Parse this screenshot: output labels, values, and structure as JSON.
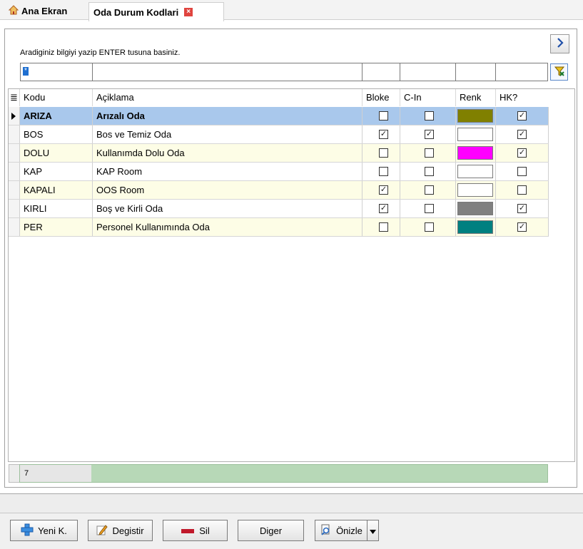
{
  "tabs": [
    {
      "label": "Ana Ekran",
      "icon": "home-icon"
    },
    {
      "label": "Oda Durum Kodlari",
      "active": true,
      "close_icon": "close-icon"
    }
  ],
  "search": {
    "hint": "Aradiginiz bilgiyi yazip ENTER tusuna basiniz.",
    "first_filter_value": "*"
  },
  "grid": {
    "columns": [
      "Kodu",
      "Açiklama",
      "Bloke",
      "C-In",
      "Renk",
      "HK?"
    ],
    "rows": [
      {
        "kodu": "ARIZA",
        "aciklama": "Arızalı Oda",
        "bloke": false,
        "cin": false,
        "renk": "#808000",
        "hk": true,
        "selected": true
      },
      {
        "kodu": "BOS",
        "aciklama": "Bos ve Temiz Oda",
        "bloke": true,
        "cin": true,
        "renk": "#ffffff",
        "hk": true
      },
      {
        "kodu": "DOLU",
        "aciklama": "Kullanımda Dolu Oda",
        "bloke": false,
        "cin": false,
        "renk": "#ff00ff",
        "hk": true
      },
      {
        "kodu": "KAP",
        "aciklama": "KAP Room",
        "bloke": false,
        "cin": false,
        "renk": "#ffffff",
        "hk": false
      },
      {
        "kodu": "KAPALI",
        "aciklama": "OOS Room",
        "bloke": true,
        "cin": false,
        "renk": "#ffffff",
        "hk": false
      },
      {
        "kodu": "KIRLI",
        "aciklama": "Boş ve Kirli Oda",
        "bloke": true,
        "cin": false,
        "renk": "#808080",
        "hk": true
      },
      {
        "kodu": "PER",
        "aciklama": "Personel Kullanımında Oda",
        "bloke": false,
        "cin": false,
        "renk": "#008080",
        "hk": true
      }
    ],
    "row_count": "7",
    "selected_row_color": "#a9c8ec",
    "alt_row_color": "#fdfde6"
  },
  "buttons": {
    "new_label": "Yeni K.",
    "edit_label": "Degistir",
    "delete_label": "Sil",
    "other_label": "Diger",
    "preview_label": "Önizle"
  }
}
